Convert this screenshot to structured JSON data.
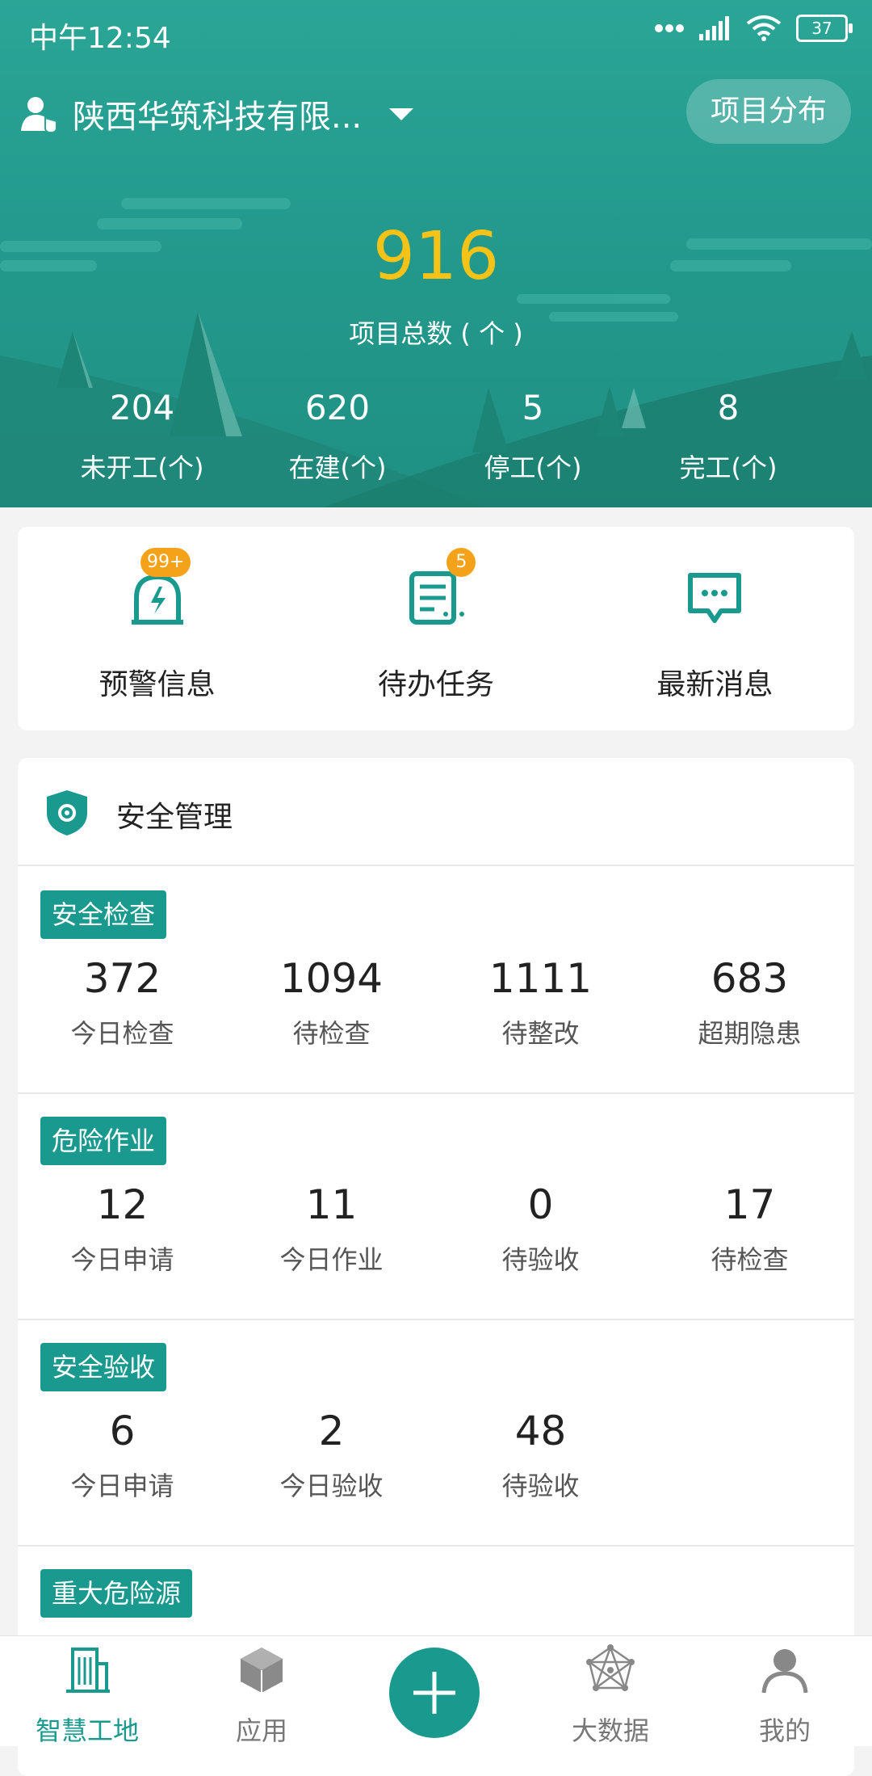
{
  "status": {
    "time": "中午12:54",
    "battery": "37",
    "icons": [
      "more-dots-icon",
      "signal-icon",
      "wifi-icon",
      "battery-icon"
    ]
  },
  "header": {
    "company_name": "陕西华筑科技有限...",
    "project_distribution_button": "项目分布"
  },
  "summary": {
    "total": "916",
    "total_label": "项目总数 ( 个 )",
    "stats": [
      {
        "value": "204",
        "label": "未开工(个)"
      },
      {
        "value": "620",
        "label": "在建(个)"
      },
      {
        "value": "5",
        "label": "停工(个)"
      },
      {
        "value": "8",
        "label": "完工(个)"
      }
    ]
  },
  "quick_actions": [
    {
      "label": "预警信息",
      "badge": "99+",
      "icon": "alarm-icon"
    },
    {
      "label": "待办任务",
      "badge": "5",
      "icon": "task-list-icon"
    },
    {
      "label": "最新消息",
      "badge": "",
      "icon": "message-icon"
    }
  ],
  "safety": {
    "title": "安全管理",
    "sections": [
      {
        "tag": "安全检查",
        "metrics": [
          {
            "value": "372",
            "label": "今日检查"
          },
          {
            "value": "1094",
            "label": "待检查"
          },
          {
            "value": "1111",
            "label": "待整改"
          },
          {
            "value": "683",
            "label": "超期隐患"
          }
        ]
      },
      {
        "tag": "危险作业",
        "metrics": [
          {
            "value": "12",
            "label": "今日申请"
          },
          {
            "value": "11",
            "label": "今日作业"
          },
          {
            "value": "0",
            "label": "待验收"
          },
          {
            "value": "17",
            "label": "待检查"
          }
        ]
      },
      {
        "tag": "安全验收",
        "metrics": [
          {
            "value": "6",
            "label": "今日申请"
          },
          {
            "value": "2",
            "label": "今日验收"
          },
          {
            "value": "48",
            "label": "待验收"
          }
        ]
      },
      {
        "tag": "重大危险源",
        "metrics": []
      }
    ]
  },
  "bottom_nav": [
    {
      "label": "智慧工地",
      "icon": "building-icon",
      "active": true
    },
    {
      "label": "应用",
      "icon": "cube-icon",
      "active": false
    },
    {
      "label": "",
      "icon": "plus-icon",
      "active": false
    },
    {
      "label": "大数据",
      "icon": "network-icon",
      "active": false
    },
    {
      "label": "我的",
      "icon": "user-icon",
      "active": false
    }
  ],
  "colors": {
    "brand_teal": "#1a9a8e",
    "hero_top": "#2aa596",
    "total_yellow": "#f5c218",
    "badge_orange": "#f5a21b"
  }
}
